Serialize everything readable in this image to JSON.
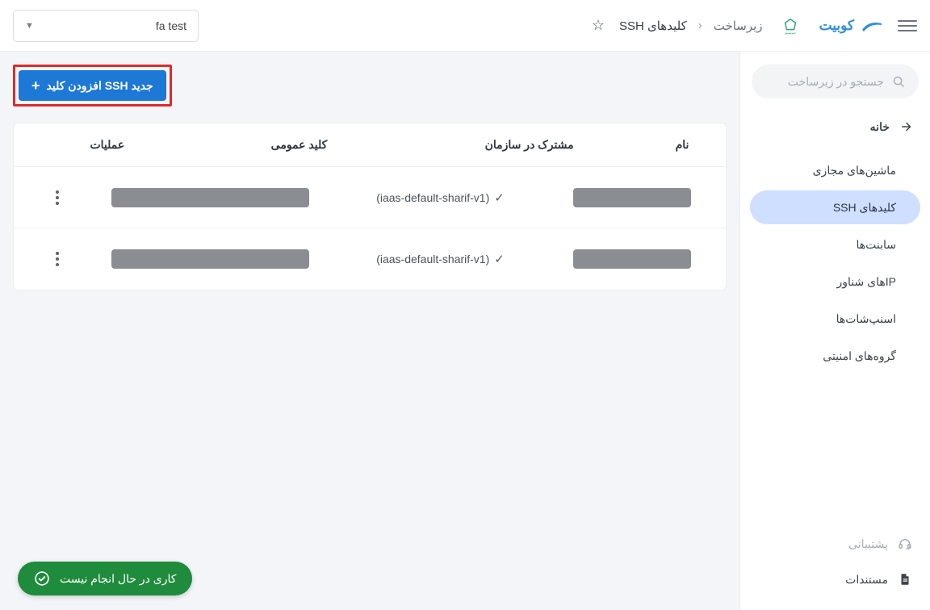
{
  "header": {
    "brand": "کوبیت",
    "breadcrumb_root": "زیرساخت",
    "breadcrumb_current": "کلیدهای SSH",
    "org_selected": "fa test"
  },
  "sidebar": {
    "search_placeholder": "جستجو در زیرساخت",
    "home_label": "خانه",
    "items": [
      {
        "label": "ماشین‌های مجازی",
        "active": false
      },
      {
        "label": "کلیدهای SSH",
        "active": true
      },
      {
        "label": "سابنت‌ها",
        "active": false
      },
      {
        "label": "IPهای شناور",
        "active": false
      },
      {
        "label": "اسنپ‌شات‌ها",
        "active": false
      },
      {
        "label": "گروه‌های امنیتی",
        "active": false
      }
    ],
    "support_label": "پشتیبانی",
    "docs_label": "مستندات"
  },
  "main": {
    "add_button": "افزودن کلید SSH جدید",
    "columns": {
      "name": "نام",
      "shared": "مشترک در سازمان",
      "pubkey": "کلید عمومی",
      "actions": "عملیات"
    },
    "rows": [
      {
        "shared_text": "(iaas-default-sharif-v1)"
      },
      {
        "shared_text": "(iaas-default-sharif-v1)"
      }
    ]
  },
  "status": {
    "text": "کاری در حال انجام نیست"
  }
}
